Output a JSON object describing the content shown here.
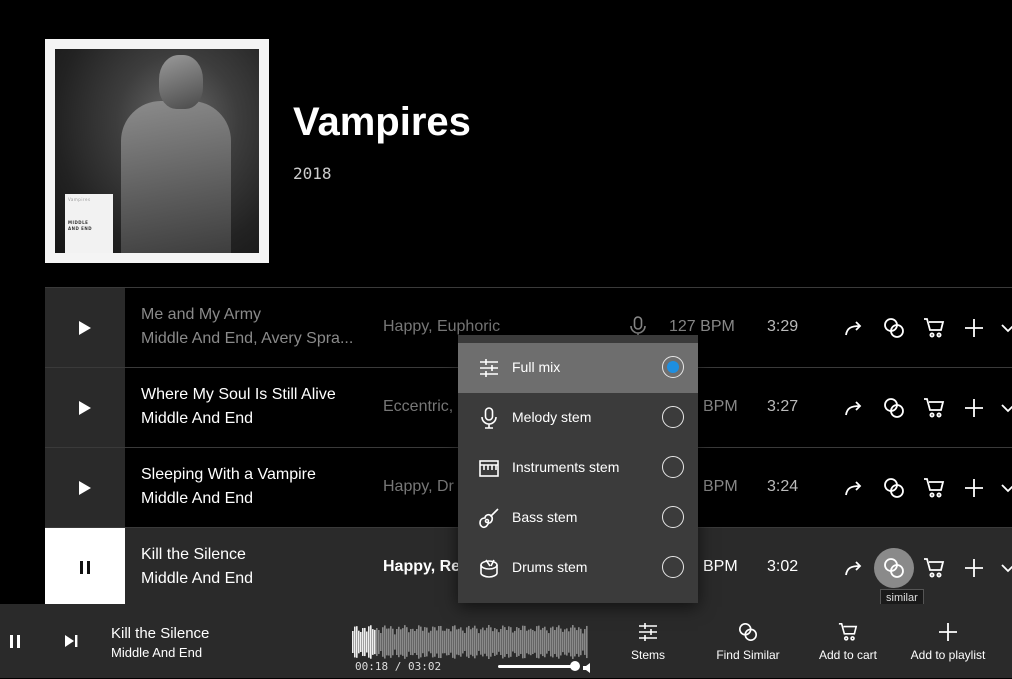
{
  "album": {
    "title": "Vampires",
    "year": "2018",
    "cover_text": {
      "name": "Vampires",
      "artist_line1": "MIDDLE",
      "artist_line2": "AND END"
    }
  },
  "tracks": [
    {
      "title": "Me and My Army",
      "artist": "Middle And End, Avery Spra...",
      "mood": "Happy, Euphoric",
      "bpm": "127 BPM",
      "duration": "3:29",
      "state": "stopped",
      "has_vocals": true
    },
    {
      "title": "Where My Soul Is Still Alive",
      "artist": "Middle And End",
      "mood": "Eccentric,",
      "bpm": "BPM",
      "duration": "3:27",
      "state": "stopped"
    },
    {
      "title": "Sleeping With a Vampire",
      "artist": "Middle And End",
      "mood": "Happy, Dr",
      "bpm": "BPM",
      "duration": "3:24",
      "state": "stopped"
    },
    {
      "title": "Kill the Silence",
      "artist": "Middle And End",
      "mood": "Happy, Re",
      "bpm": "BPM",
      "duration": "3:02",
      "state": "playing"
    }
  ],
  "stem_menu": {
    "items": [
      {
        "label": "Full mix",
        "icon": "sliders-icon",
        "selected": true
      },
      {
        "label": "Melody stem",
        "icon": "microphone-icon",
        "selected": false
      },
      {
        "label": "Instruments stem",
        "icon": "piano-icon",
        "selected": false
      },
      {
        "label": "Bass stem",
        "icon": "guitar-icon",
        "selected": false
      },
      {
        "label": "Drums stem",
        "icon": "drum-icon",
        "selected": false
      }
    ]
  },
  "tooltip": {
    "similar": "similar"
  },
  "player": {
    "title": "Kill the Silence",
    "artist": "Middle And End",
    "time": "00:18 / 03:02",
    "progress": 0.1,
    "volume": 0.95,
    "buttons": {
      "stems": "Stems",
      "find_similar": "Find Similar",
      "add_to_cart": "Add to cart",
      "add_to_playlist": "Add to playlist"
    }
  },
  "colors": {
    "accent": "#1e8fe1",
    "menu_bg": "#3b3b3b",
    "row_bg": "#2a2a2a"
  }
}
